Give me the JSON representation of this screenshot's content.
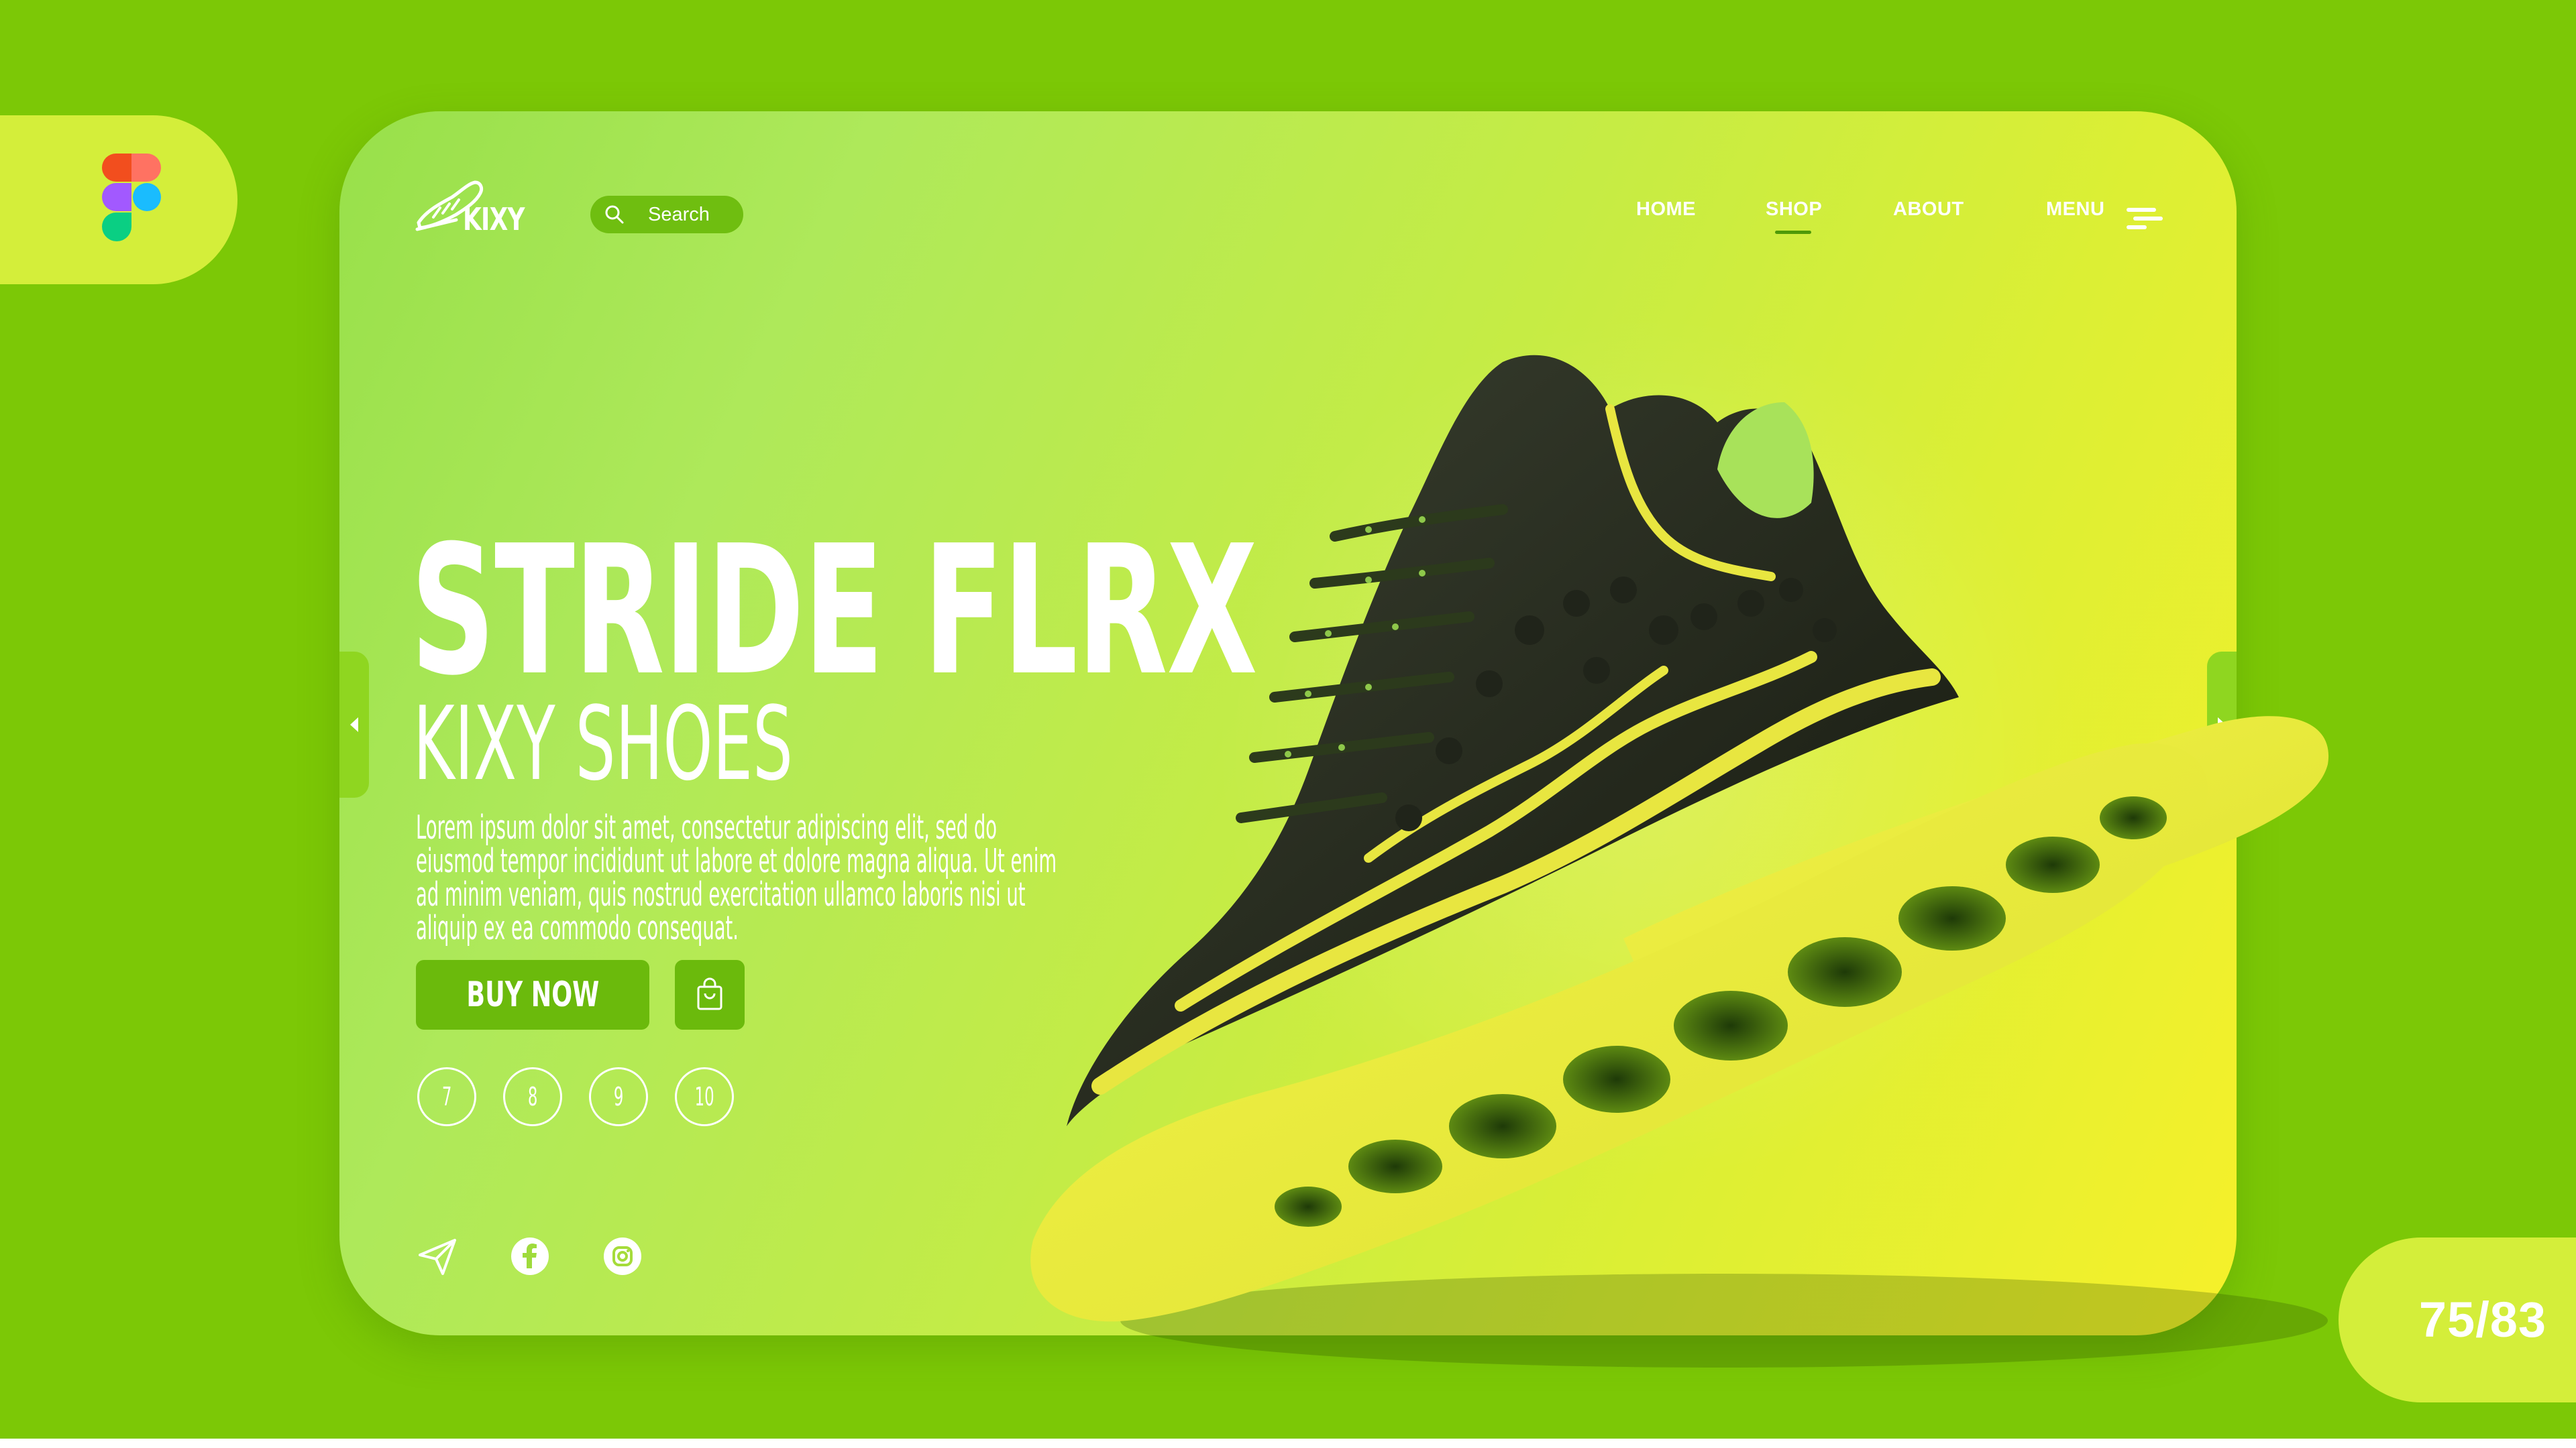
{
  "brand": {
    "name": "KIXY"
  },
  "search": {
    "label": "Search"
  },
  "nav": {
    "items": [
      {
        "label": "HOME",
        "active": false
      },
      {
        "label": "SHOP",
        "active": true
      },
      {
        "label": "ABOUT",
        "active": false
      }
    ],
    "menu_label": "MENU"
  },
  "hero": {
    "title": "STRIDE FLRX",
    "subtitle": "KIXY SHOES",
    "description": "Lorem ipsum dolor sit amet, consectetur adipiscing elit, sed do eiusmod tempor incididunt ut labore et dolore magna aliqua. Ut enim ad minim veniam, quis nostrud exercitation ullamco laboris nisi ut aliquip ex ea commodo consequat.",
    "buy_label": "BUY NOW",
    "sizes": [
      "7",
      "8",
      "9",
      "10"
    ]
  },
  "social": [
    "send-icon",
    "facebook-icon",
    "instagram-icon"
  ],
  "pager": {
    "text": "75/83"
  },
  "colors": {
    "background": "#7cc806",
    "accent_button": "#6bba0c",
    "badge": "#d4ee3a",
    "card_gradient_start": "#98e04a",
    "card_gradient_end": "#f6f02a"
  }
}
